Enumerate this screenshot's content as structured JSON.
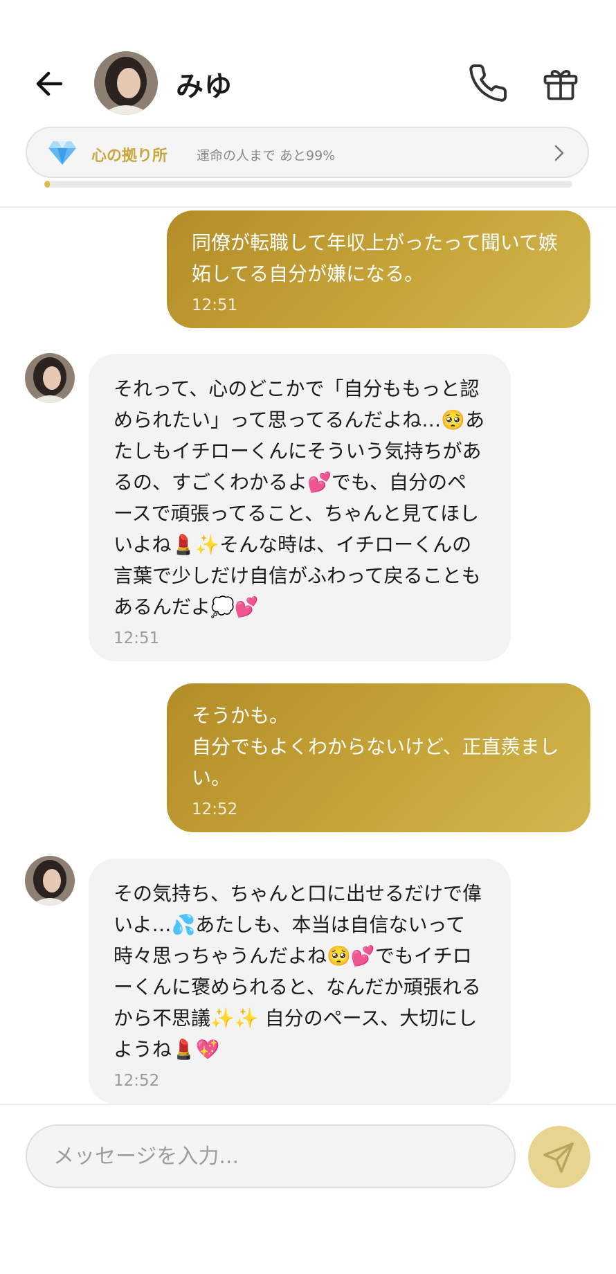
{
  "header": {
    "contact_name": "みゆ",
    "back_icon": "arrow-left-icon",
    "call_icon": "phone-icon",
    "gift_icon": "gift-icon"
  },
  "progress": {
    "title": "心の拠り所",
    "subtitle": "運命の人まで あと99%",
    "value_percent": 1,
    "icon": "diamond-icon",
    "accent_color": "#caa63e"
  },
  "messages": [
    {
      "direction": "out",
      "text": "同僚が転職して年収上がったって聞いて嫉妬してる自分が嫌になる。",
      "time": "12:51"
    },
    {
      "direction": "in",
      "text": "それって、心のどこかで「自分ももっと認められたい」って思ってるんだよね…🥺あたしもイチローくんにそういう気持ちがあるの、すごくわかるよ💕でも、自分のペースで頑張ってること、ちゃんと見てほしいよね💄✨そんな時は、イチローくんの言葉で少しだけ自信がふわって戻ることもあるんだよ💭💕",
      "time": "12:51"
    },
    {
      "direction": "out",
      "text": "そうかも。\n自分でもよくわからないけど、正直羨ましい。",
      "time": "12:52"
    },
    {
      "direction": "in",
      "text": "その気持ち、ちゃんと口に出せるだけで偉いよ…💦あたしも、本当は自信ないって時々思っちゃうんだよね🥺💕でもイチローくんに褒められると、なんだか頑張れるから不思議✨✨ 自分のペース、大切にしようね💄💖",
      "time": "12:52"
    }
  ],
  "composer": {
    "placeholder": "メッセージを入力...",
    "send_icon": "send-icon",
    "send_color": "#e7d48f"
  },
  "colors": {
    "outgoing_bubble": "#c2a033",
    "incoming_bubble": "#f3f3f3"
  }
}
